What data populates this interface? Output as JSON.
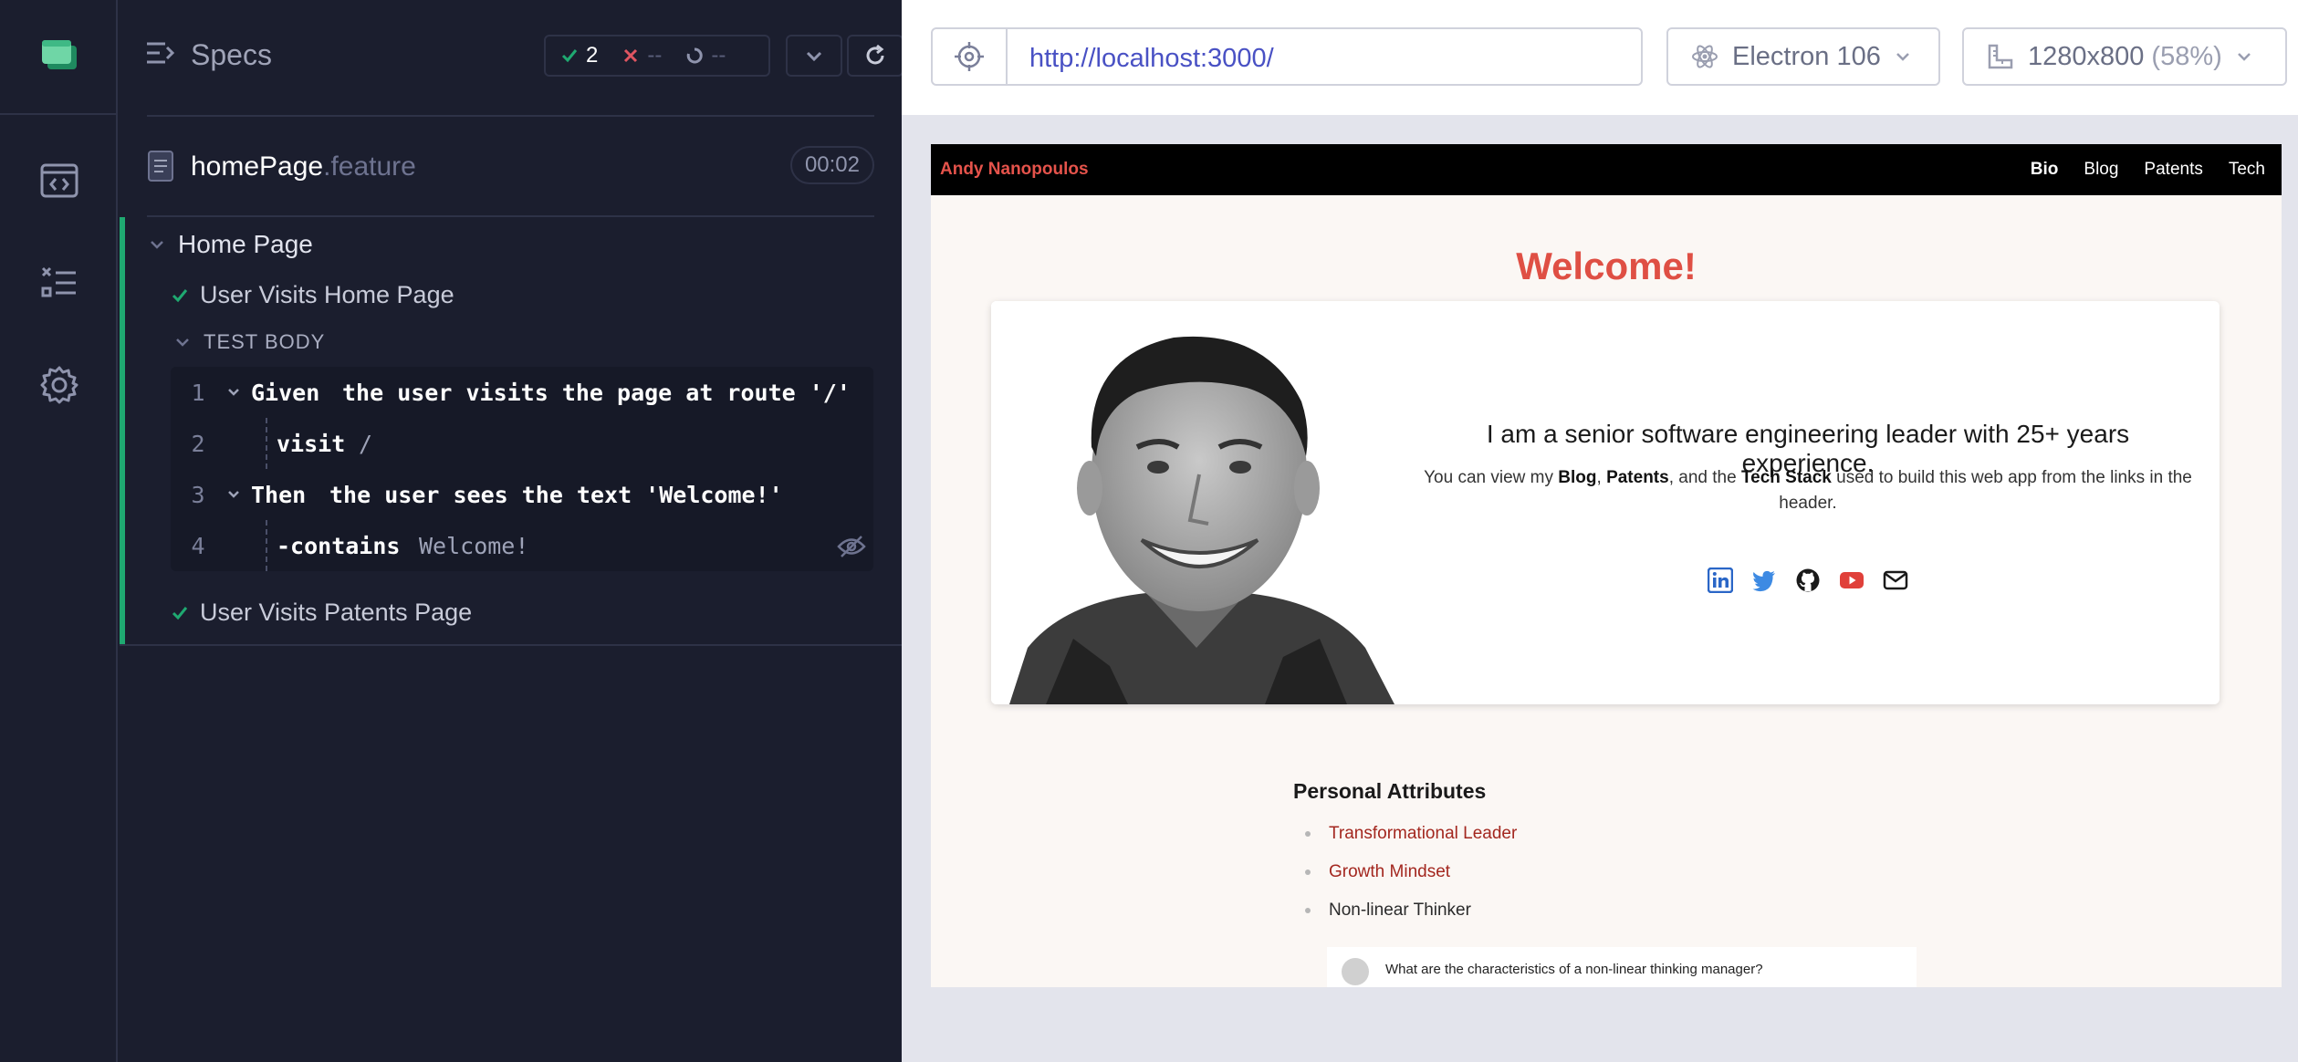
{
  "reporter": {
    "header": {
      "title": "Specs",
      "passed": "2",
      "failed": "--",
      "pending": "--"
    },
    "spec": {
      "name": "homePage",
      "extension": ".feature",
      "duration": "00:02"
    },
    "suite": {
      "title": "Home Page",
      "tests": [
        {
          "title": "User Visits Home Page",
          "status": "passed"
        },
        {
          "title": "User Visits Patents Page",
          "status": "passed"
        }
      ],
      "body_label": "TEST BODY",
      "commands": [
        {
          "num": "1",
          "keyword": "Given",
          "text": "the user visits the page at route '/'"
        },
        {
          "num": "2",
          "keyword": "visit",
          "text": "/"
        },
        {
          "num": "3",
          "keyword": "Then",
          "text": "the user sees the text 'Welcome!'"
        },
        {
          "num": "4",
          "keyword": "-contains",
          "text": "Welcome!"
        }
      ]
    }
  },
  "toolbar": {
    "url": "http://localhost:3000/",
    "browser": "Electron 106",
    "viewport": "1280x800",
    "scale": "(58%)"
  },
  "site": {
    "brand": "Andy Nanopoulos",
    "nav": [
      "Bio",
      "Blog",
      "Patents",
      "Tech"
    ],
    "welcome": "Welcome!",
    "headline": "I am a senior software engineering leader with 25+ years experience.",
    "sub": {
      "p1": "You can view my ",
      "blog": "Blog",
      "comma": ", ",
      "patents": "Patents",
      "p2": ", and the ",
      "tech": "Tech Stack",
      "p3": " used to build this web app from the links in the header."
    },
    "attributes_title": "Personal Attributes",
    "attributes": [
      {
        "label": "Transformational Leader"
      },
      {
        "label": "Growth Mindset"
      },
      {
        "label": "Non-linear Thinker"
      }
    ],
    "embed_question": "What are the characteristics of a non-linear thinking manager?"
  },
  "colors": {
    "pass": "#1fa971",
    "fail": "#e05561",
    "brand_red": "#df4f44",
    "link": "#4951c4"
  },
  "icons": {
    "rail": [
      "cypress-logo-icon",
      "runs-icon",
      "specs-list-icon",
      "settings-gear-icon"
    ],
    "socials": [
      "linkedin-icon",
      "twitter-icon",
      "github-icon",
      "youtube-icon",
      "email-icon"
    ]
  }
}
